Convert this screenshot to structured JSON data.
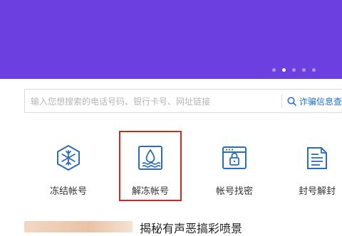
{
  "banner": {
    "color": "#6b3fe0",
    "slide_count": 5,
    "active_slide": 2
  },
  "search": {
    "placeholder": "输入您想搜索的电话号码、银行卡号、网址链接",
    "button_label": "诈骗信息查询",
    "button_icon": "search-icon",
    "accent": "#1e6fd9"
  },
  "tiles": [
    {
      "label": "冻结帐号",
      "icon": "snowflake-icon"
    },
    {
      "label": "解冻帐号",
      "icon": "water-drop-icon",
      "highlighted": true
    },
    {
      "label": "帐号找密",
      "icon": "browser-lock-icon"
    },
    {
      "label": "封号解封",
      "icon": "document-list-icon"
    }
  ],
  "icon_color": "#2a6db9",
  "highlight_color": "#d7261e",
  "news": {
    "title": "揭秘有声恶搞彩喷景"
  }
}
